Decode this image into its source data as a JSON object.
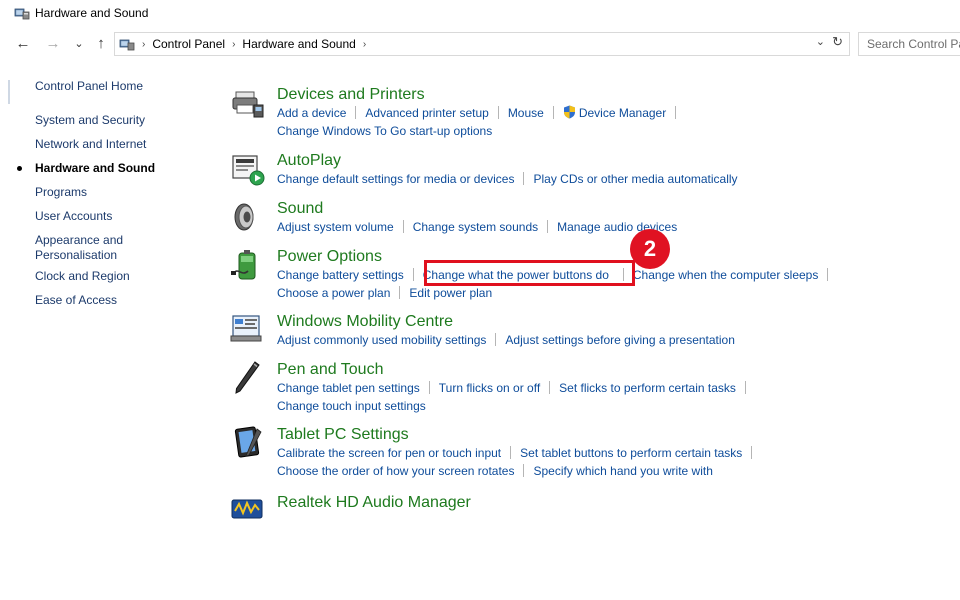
{
  "window": {
    "title": "Hardware and Sound"
  },
  "navigation": {
    "back_glyph": "←",
    "forward_glyph": "→",
    "recent_glyph": "⌄",
    "up_glyph": "↑"
  },
  "address": {
    "breadcrumbs": [
      "Control Panel",
      "Hardware and Sound"
    ],
    "separator": "›",
    "dropdown_glyph": "⌄",
    "refresh_glyph": "↻"
  },
  "search": {
    "placeholder": "Search Control Panel"
  },
  "sidebar": {
    "items": [
      {
        "label": "Control Panel Home"
      },
      {
        "label": "System and Security"
      },
      {
        "label": "Network and Internet"
      },
      {
        "label": "Hardware and Sound",
        "current": true
      },
      {
        "label": "Programs"
      },
      {
        "label": "User Accounts"
      },
      {
        "label": "Appearance and Personalisation"
      },
      {
        "label": "Clock and Region"
      },
      {
        "label": "Ease of Access"
      }
    ]
  },
  "categories": [
    {
      "title": "Devices and Printers",
      "icon": "printer-icon",
      "links": [
        [
          "Add a device",
          "Advanced printer setup",
          "Mouse",
          "Device Manager"
        ],
        [
          "Change Windows To Go start-up options"
        ]
      ]
    },
    {
      "title": "AutoPlay",
      "icon": "autoplay-icon",
      "links": [
        [
          "Change default settings for media or devices",
          "Play CDs or other media automatically"
        ]
      ]
    },
    {
      "title": "Sound",
      "icon": "speaker-icon",
      "links": [
        [
          "Adjust system volume",
          "Change system sounds",
          "Manage audio devices"
        ]
      ]
    },
    {
      "title": "Power Options",
      "icon": "battery-icon",
      "links": [
        [
          "Change battery settings",
          "Change what the power buttons do",
          "Change when the computer sleeps"
        ],
        [
          "Choose a power plan",
          "Edit power plan"
        ]
      ]
    },
    {
      "title": "Windows Mobility Centre",
      "icon": "mobility-icon",
      "links": [
        [
          "Adjust commonly used mobility settings",
          "Adjust settings before giving a presentation"
        ]
      ]
    },
    {
      "title": "Pen and Touch",
      "icon": "pen-icon",
      "links": [
        [
          "Change tablet pen settings",
          "Turn flicks on or off",
          "Set flicks to perform certain tasks"
        ],
        [
          "Change touch input settings"
        ]
      ]
    },
    {
      "title": "Tablet PC Settings",
      "icon": "tablet-icon",
      "links": [
        [
          "Calibrate the screen for pen or touch input",
          "Set tablet buttons to perform certain tasks"
        ],
        [
          "Choose the order of how your screen rotates",
          "Specify which hand you write with"
        ]
      ]
    },
    {
      "title": "Realtek HD Audio Manager",
      "icon": "realtek-icon",
      "links": []
    }
  ],
  "annotation": {
    "step_number": "2",
    "highlight_color": "#e0101e"
  }
}
